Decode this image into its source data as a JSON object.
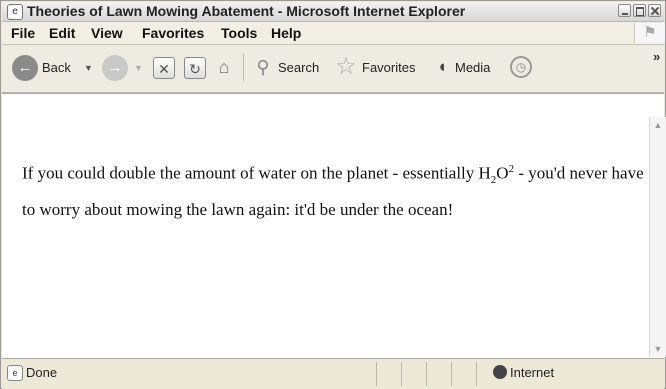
{
  "window": {
    "title": "Theories of Lawn Mowing Abatement - Microsoft Internet Explorer"
  },
  "menu": [
    "File",
    "Edit",
    "View",
    "Favorites",
    "Tools",
    "Help"
  ],
  "toolbar": {
    "back_label": "Back",
    "search_label": "Search",
    "favorites_label": "Favorites",
    "media_label": "Media",
    "more_label": "»"
  },
  "content": {
    "text_before": "If you could double the amount of water on the planet - essentially H",
    "sub": "2",
    "mid": "O",
    "sup": "2",
    "text_after": " - you'd never have to worry about mowing the lawn again: it'd be under the ocean!"
  },
  "status": {
    "left": "Done",
    "zone": "Internet"
  }
}
